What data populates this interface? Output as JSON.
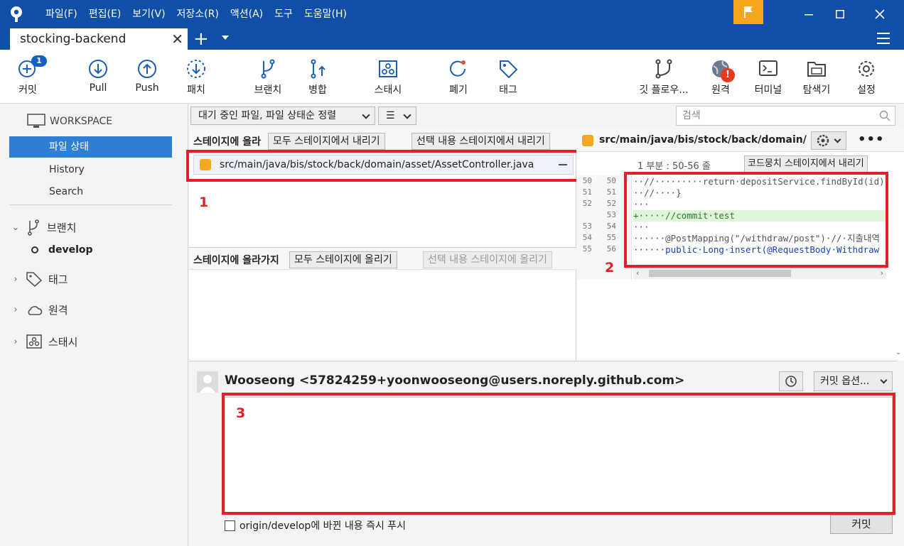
{
  "menu": [
    "파일(F)",
    "편집(E)",
    "보기(V)",
    "저장소(R)",
    "액션(A)",
    "도구",
    "도움말(H)"
  ],
  "tab": {
    "title": "stocking-backend",
    "add": "+"
  },
  "toolbar": {
    "commit": "커밋",
    "commit_badge": "1",
    "pull": "Pull",
    "push": "Push",
    "fetch": "패치",
    "branch": "브랜치",
    "merge": "병합",
    "stash": "스태시",
    "discard": "폐기",
    "tag": "태그",
    "git_flow": "깃 플로우...",
    "remote": "원격",
    "remote_badge": "!",
    "terminal": "터미널",
    "explorer": "탐색기",
    "settings": "설정"
  },
  "sidebar": {
    "workspace": "WORKSPACE",
    "file_status": "파일 상태",
    "history": "History",
    "search": "Search",
    "branches": "브랜치",
    "current_branch": "develop",
    "tags": "태그",
    "remotes": "원격",
    "stashes": "스태시"
  },
  "filter": {
    "pending_sort": "대기 중인 파일, 파일 상태순 정렬",
    "view_icon": "☰",
    "search_placeholder": "검색"
  },
  "staged": {
    "title": "스테이지에 올라",
    "unstage_all": "모두 스테이지에서 내리기",
    "unstage_selected": "선택 내용 스테이지에서 내리기",
    "files": [
      "src/main/java/bis/stock/back/domain/asset/AssetController.java"
    ]
  },
  "unstaged": {
    "title": "스테이지에 올라가지",
    "stage_all": "모두 스테이지에 올리기",
    "stage_selected": "선택 내용 스테이지에 올리기"
  },
  "diff": {
    "path": "src/main/java/bis/stock/back/domain/asse...",
    "hunk_title": "1 부분 : 50-56 줄",
    "hunk_button": "코드뭉치 스테이지에서 내리기",
    "more": "•••",
    "lines": [
      {
        "old": "50",
        "new": "50",
        "text": "··//·········return·depositService.findById(id);",
        "type": "context"
      },
      {
        "old": "51",
        "new": "51",
        "text": "··//····}",
        "type": "context"
      },
      {
        "old": "52",
        "new": "52",
        "text": "···",
        "type": "context"
      },
      {
        "old": "",
        "new": "53",
        "text": "+·····//commit·test",
        "type": "added"
      },
      {
        "old": "53",
        "new": "54",
        "text": "···",
        "type": "context"
      },
      {
        "old": "54",
        "new": "55",
        "text": "······@PostMapping(\"/withdraw/post\")·//·지출내역",
        "type": "context"
      },
      {
        "old": "55",
        "new": "56",
        "text": "······public·Long·insert(@RequestBody·Withdraw",
        "type": "context"
      }
    ]
  },
  "annotations": [
    "1",
    "2",
    "3"
  ],
  "commit": {
    "author": "Wooseong <57824259+yoonwooseong@users.noreply.github.com>",
    "options": "커밋 옵션...",
    "push_label": "origin/develop에 바뀐 내용 즉시 푸시",
    "commit_button": "커밋",
    "message": ""
  },
  "colors": {
    "titlebar": "#0f4fa8",
    "selection": "#2f7fd6",
    "annotation": "#e3202a",
    "modified": "#f5a623"
  }
}
